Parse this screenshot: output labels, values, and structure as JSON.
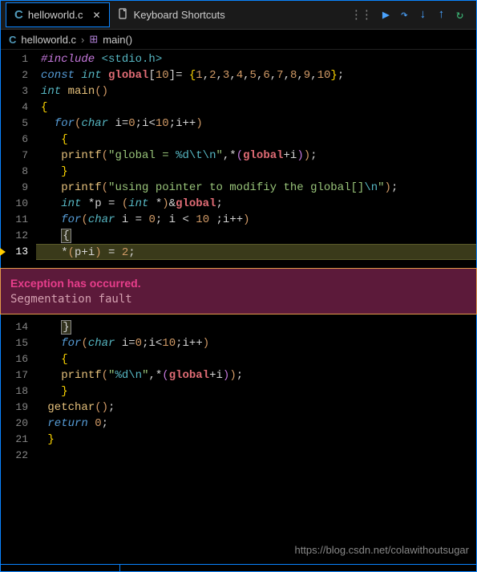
{
  "tabs": [
    {
      "icon": "C",
      "label": "helloworld.c",
      "active": true,
      "closable": true
    },
    {
      "icon": "file",
      "label": "Keyboard Shortcuts",
      "active": false,
      "closable": false
    }
  ],
  "breadcrumb": {
    "file_icon": "C",
    "file": "helloworld.c",
    "sep": "›",
    "fn_icon": "⊞",
    "fn": "main()"
  },
  "exception": {
    "title": "Exception has occurred.",
    "msg": "Segmentation fault"
  },
  "current_line": 13,
  "lines": {
    "1": [
      [
        "pp",
        "#include "
      ],
      [
        "inc",
        "<stdio.h>"
      ]
    ],
    "2": [
      [
        "kw",
        "const "
      ],
      [
        "type",
        "int "
      ],
      [
        "var",
        "global"
      ],
      [
        "op",
        "["
      ],
      [
        "num",
        "10"
      ],
      [
        "op",
        "]= "
      ],
      [
        "brace",
        "{"
      ],
      [
        "num",
        "1"
      ],
      [
        "op",
        ","
      ],
      [
        "num",
        "2"
      ],
      [
        "op",
        ","
      ],
      [
        "num",
        "3"
      ],
      [
        "op",
        ","
      ],
      [
        "num",
        "4"
      ],
      [
        "op",
        ","
      ],
      [
        "num",
        "5"
      ],
      [
        "op",
        ","
      ],
      [
        "num",
        "6"
      ],
      [
        "op",
        ","
      ],
      [
        "num",
        "7"
      ],
      [
        "op",
        ","
      ],
      [
        "num",
        "8"
      ],
      [
        "op",
        ","
      ],
      [
        "num",
        "9"
      ],
      [
        "op",
        ","
      ],
      [
        "num",
        "10"
      ],
      [
        "brace",
        "}"
      ],
      [
        "op",
        ";"
      ]
    ],
    "3": [
      [
        "type",
        "int "
      ],
      [
        "fn",
        "main"
      ],
      [
        "paren1",
        "()"
      ]
    ],
    "4": [
      [
        "brace",
        "{"
      ]
    ],
    "5": [
      [
        "op",
        "  "
      ],
      [
        "kw",
        "for"
      ],
      [
        "paren1",
        "("
      ],
      [
        "type",
        "char "
      ],
      [
        "op",
        "i="
      ],
      [
        "num",
        "0"
      ],
      [
        "op",
        ";i<"
      ],
      [
        "num",
        "10"
      ],
      [
        "op",
        ";i++"
      ],
      [
        "paren1",
        ")"
      ]
    ],
    "6": [
      [
        "op",
        "   "
      ],
      [
        "brace",
        "{"
      ]
    ],
    "7": [
      [
        "op",
        "   "
      ],
      [
        "fn",
        "printf"
      ],
      [
        "paren1",
        "("
      ],
      [
        "str",
        "\"global = "
      ],
      [
        "esc",
        "%d\\t\\n"
      ],
      [
        "str",
        "\""
      ],
      [
        "op",
        ",*"
      ],
      [
        "paren2",
        "("
      ],
      [
        "var",
        "global"
      ],
      [
        "op",
        "+i"
      ],
      [
        "paren2",
        ")"
      ],
      [
        "paren1",
        ")"
      ],
      [
        "op",
        ";"
      ]
    ],
    "8": [
      [
        "op",
        "   "
      ],
      [
        "brace",
        "}"
      ]
    ],
    "9": [
      [
        "op",
        "   "
      ],
      [
        "fn",
        "printf"
      ],
      [
        "paren1",
        "("
      ],
      [
        "str",
        "\"using pointer to modifiy the global[]"
      ],
      [
        "esc",
        "\\n"
      ],
      [
        "str",
        "\""
      ],
      [
        "paren1",
        ")"
      ],
      [
        "op",
        ";"
      ]
    ],
    "10": [
      [
        "op",
        "   "
      ],
      [
        "type",
        "int "
      ],
      [
        "op",
        "*p = "
      ],
      [
        "paren1",
        "("
      ],
      [
        "type",
        "int "
      ],
      [
        "op",
        "*"
      ],
      [
        "paren1",
        ")"
      ],
      [
        "op",
        "&"
      ],
      [
        "var",
        "global"
      ],
      [
        "op",
        ";"
      ]
    ],
    "11": [
      [
        "op",
        "   "
      ],
      [
        "kw",
        "for"
      ],
      [
        "paren1",
        "("
      ],
      [
        "type",
        "char "
      ],
      [
        "op",
        "i = "
      ],
      [
        "num",
        "0"
      ],
      [
        "op",
        "; i < "
      ],
      [
        "num",
        "10"
      ],
      [
        "op",
        " ;i++"
      ],
      [
        "paren1",
        ")"
      ]
    ],
    "12": [
      [
        "op",
        "   "
      ],
      [
        "cursor",
        "{"
      ]
    ],
    "13": [
      [
        "op",
        "   *"
      ],
      [
        "paren1",
        "("
      ],
      [
        "op",
        "p+i"
      ],
      [
        "paren1",
        ")"
      ],
      [
        "op",
        " = "
      ],
      [
        "num",
        "2"
      ],
      [
        "op",
        ";"
      ]
    ],
    "14": [
      [
        "op",
        "   "
      ],
      [
        "cursor",
        "}"
      ]
    ],
    "15": [
      [
        "op",
        "   "
      ],
      [
        "kw",
        "for"
      ],
      [
        "paren1",
        "("
      ],
      [
        "type",
        "char "
      ],
      [
        "op",
        "i="
      ],
      [
        "num",
        "0"
      ],
      [
        "op",
        ";i<"
      ],
      [
        "num",
        "10"
      ],
      [
        "op",
        ";i++"
      ],
      [
        "paren1",
        ")"
      ]
    ],
    "16": [
      [
        "op",
        "   "
      ],
      [
        "brace",
        "{"
      ]
    ],
    "17": [
      [
        "op",
        "   "
      ],
      [
        "fn",
        "printf"
      ],
      [
        "paren1",
        "("
      ],
      [
        "str",
        "\""
      ],
      [
        "esc",
        "%d\\n"
      ],
      [
        "str",
        "\""
      ],
      [
        "op",
        ",*"
      ],
      [
        "paren2",
        "("
      ],
      [
        "var",
        "global"
      ],
      [
        "op",
        "+i"
      ],
      [
        "paren2",
        ")"
      ],
      [
        "paren1",
        ")"
      ],
      [
        "op",
        ";"
      ]
    ],
    "18": [
      [
        "op",
        "   "
      ],
      [
        "brace",
        "}"
      ]
    ],
    "19": [
      [
        "op",
        " "
      ],
      [
        "fn",
        "getchar"
      ],
      [
        "paren1",
        "()"
      ],
      [
        "op",
        ";"
      ]
    ],
    "20": [
      [
        "op",
        " "
      ],
      [
        "kw",
        "return "
      ],
      [
        "num",
        "0"
      ],
      [
        "op",
        ";"
      ]
    ],
    "21": [
      [
        "op",
        " "
      ],
      [
        "brace",
        "}"
      ]
    ],
    "22": [
      [
        "op",
        ""
      ]
    ]
  },
  "footer_url": "https://blog.csdn.net/colawithoutsugar"
}
